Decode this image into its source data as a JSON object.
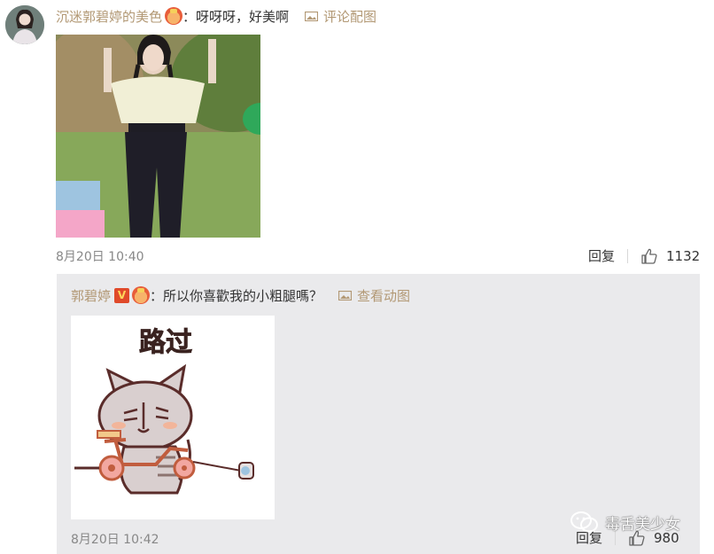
{
  "comment": {
    "username": "沉迷郭碧婷的美色",
    "content": "：呀呀呀，好美啊",
    "view_image_link": "评论配图",
    "timestamp": "8月20日 10:40",
    "reply_label": "回复",
    "like_count": "1132"
  },
  "reply": {
    "username": "郭碧婷",
    "verified_badge": "V",
    "content": "：所以你喜歡我的小粗腿嗎？",
    "view_image_link": "查看动图",
    "sticker_text": "路过",
    "timestamp": "8月20日 10:42",
    "reply_label": "回复",
    "like_count": "980"
  },
  "watermark": {
    "text": "毒舌美少女"
  },
  "colors": {
    "username": "#b29874",
    "reply_background": "#eaeaec",
    "timestamp": "#888888"
  }
}
